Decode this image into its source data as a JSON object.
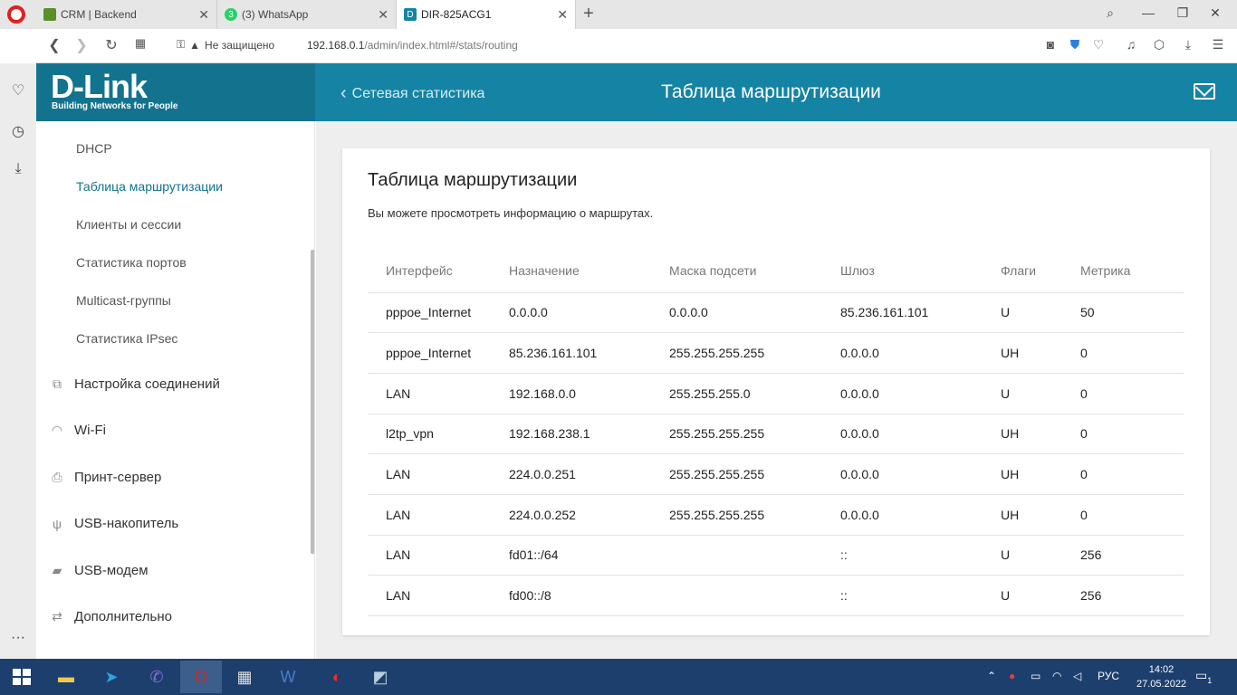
{
  "browser": {
    "tabs": [
      {
        "title": "CRM | Backend",
        "favicon_color": "#5a8f29"
      },
      {
        "title": "(3) WhatsApp",
        "favicon_color": "#25d366",
        "badge": "3"
      },
      {
        "title": "DIR-825ACG1",
        "favicon_color": "#1583a3",
        "favicon_letter": "D"
      }
    ],
    "security_label": "Не защищено",
    "url_host": "192.168.0.1",
    "url_path": "/admin/index.html#/stats/routing"
  },
  "header": {
    "logo": "D-Link",
    "tagline": "Building Networks for People",
    "back_label": "Сетевая статистика",
    "title": "Таблица маршрутизации"
  },
  "menu": {
    "sub_items": [
      "DHCP",
      "Таблица маршрутизации",
      "Клиенты и сессии",
      "Статистика портов",
      "Multicast-группы",
      "Статистика IPsec"
    ],
    "main_items": [
      "Настройка соединений",
      "Wi-Fi",
      "Принт-сервер",
      "USB-накопитель",
      "USB-модем",
      "Дополнительно"
    ]
  },
  "card": {
    "title": "Таблица маршрутизации",
    "description": "Вы можете просмотреть информацию о маршрутах.",
    "columns": [
      "Интерфейс",
      "Назначение",
      "Маска подсети",
      "Шлюз",
      "Флаги",
      "Метрика"
    ],
    "rows": [
      [
        "pppoe_Internet",
        "0.0.0.0",
        "0.0.0.0",
        "85.236.161.101",
        "U",
        "50"
      ],
      [
        "pppoe_Internet",
        "85.236.161.101",
        "255.255.255.255",
        "0.0.0.0",
        "UH",
        "0"
      ],
      [
        "LAN",
        "192.168.0.0",
        "255.255.255.0",
        "0.0.0.0",
        "U",
        "0"
      ],
      [
        "l2tp_vpn",
        "192.168.238.1",
        "255.255.255.255",
        "0.0.0.0",
        "UH",
        "0"
      ],
      [
        "LAN",
        "224.0.0.251",
        "255.255.255.255",
        "0.0.0.0",
        "UH",
        "0"
      ],
      [
        "LAN",
        "224.0.0.252",
        "255.255.255.255",
        "0.0.0.0",
        "UH",
        "0"
      ],
      [
        "LAN",
        "fd01::/64",
        "",
        "::",
        "U",
        "256"
      ],
      [
        "LAN",
        "fd00::/8",
        "",
        "::",
        "U",
        "256"
      ]
    ]
  },
  "taskbar": {
    "language": "РУС",
    "time": "14:02",
    "date": "27.05.2022",
    "notification_count": "1"
  },
  "colors": {
    "brand": "#1583a3",
    "brand_dark": "#13738f",
    "taskbar": "#1c3f6e"
  }
}
